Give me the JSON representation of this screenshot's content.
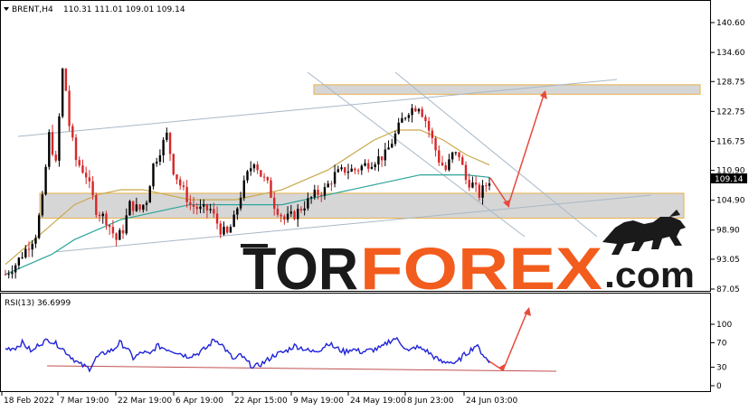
{
  "header": {
    "symbol": "BRENT,H4",
    "ohlc": "110.31 111.01 109.01 109.14"
  },
  "price_badge": "109.14",
  "rsi_header": "RSI(13) 36.6999",
  "watermark": {
    "tor": "TOR",
    "forex": "FOREX",
    "dotcom": ".com",
    "dark_color": "#1a1a1a",
    "orange_color": "#f25c1c"
  },
  "colors": {
    "bull": "#000000",
    "bear": "#d62728",
    "ma_slow": "#2ca49a",
    "ma_fast": "#c9a84a",
    "rsi": "#1f23d6",
    "trend": "#a8b8c8",
    "arrow": "#e84a3c",
    "zone_fill": "#d6d6d6",
    "zone_border": "#e8b04a"
  },
  "chart_data": [
    {
      "type": "candlestick",
      "series_name": "BRENT,H4",
      "x_ticks": [
        "18 Feb 2022",
        "7 Mar 19:00",
        "22 Mar 19:00",
        "6 Apr 19:00",
        "22 Apr 15:00",
        "9 May 19:00",
        "24 May 19:00",
        "8 Jun 23:00",
        "24 Jun 03:00"
      ],
      "y_ticks": [
        87.05,
        93.05,
        98.9,
        104.9,
        110.9,
        116.75,
        122.75,
        128.75,
        134.6,
        140.6
      ],
      "ylim": [
        87.05,
        140.6
      ],
      "last_price": 109.14,
      "path_points": [
        [
          0,
          90
        ],
        [
          3,
          92
        ],
        [
          6,
          95
        ],
        [
          9,
          98
        ],
        [
          11,
          105
        ],
        [
          13,
          118
        ],
        [
          15,
          112
        ],
        [
          17,
          131
        ],
        [
          18,
          127
        ],
        [
          19,
          120
        ],
        [
          21,
          113
        ],
        [
          24,
          110
        ],
        [
          27,
          103
        ],
        [
          30,
          101
        ],
        [
          33,
          97
        ],
        [
          35,
          99
        ],
        [
          37,
          104
        ],
        [
          40,
          103
        ],
        [
          42,
          105
        ],
        [
          44,
          112
        ],
        [
          46,
          115
        ],
        [
          48,
          118
        ],
        [
          50,
          111
        ],
        [
          52,
          108
        ],
        [
          55,
          104
        ],
        [
          58,
          103
        ],
        [
          61,
          103
        ],
        [
          64,
          99
        ],
        [
          66,
          98
        ],
        [
          68,
          101
        ],
        [
          70,
          106
        ],
        [
          72,
          110
        ],
        [
          74,
          113
        ],
        [
          76,
          110
        ],
        [
          78,
          108
        ],
        [
          80,
          104
        ],
        [
          83,
          101
        ],
        [
          86,
          102
        ],
        [
          89,
          104
        ],
        [
          92,
          106
        ],
        [
          95,
          107
        ],
        [
          98,
          110
        ],
        [
          101,
          111
        ],
        [
          104,
          111
        ],
        [
          107,
          112
        ],
        [
          110,
          113
        ],
        [
          113,
          114
        ],
        [
          116,
          118
        ],
        [
          118,
          121
        ],
        [
          120,
          123
        ],
        [
          123,
          124
        ],
        [
          125,
          121
        ],
        [
          127,
          117
        ],
        [
          129,
          113
        ],
        [
          131,
          111
        ],
        [
          133,
          114
        ],
        [
          135,
          114
        ],
        [
          137,
          109
        ],
        [
          139,
          108
        ],
        [
          141,
          106
        ],
        [
          143,
          108
        ],
        [
          144,
          109
        ]
      ],
      "zones": [
        [
          126.2,
          128.1
        ],
        [
          101.3,
          106.3
        ]
      ],
      "moving_averages": [
        {
          "name": "MA slow",
          "values": [
            90,
            92,
            94,
            97,
            99,
            101,
            102,
            103,
            104,
            104,
            104,
            104,
            104,
            105,
            106,
            107,
            108,
            109,
            110,
            110,
            110,
            109.5
          ]
        },
        {
          "name": "MA fast",
          "values": [
            92,
            96,
            100,
            104,
            106,
            107,
            107,
            106,
            105,
            105,
            105,
            106,
            107,
            109,
            111,
            114,
            117,
            119,
            119,
            117,
            114,
            112
          ]
        }
      ]
    },
    {
      "type": "line",
      "series_name": "RSI(13)",
      "y_ticks": [
        0,
        30,
        70,
        100
      ],
      "ylim": [
        0,
        100
      ],
      "last_value": 36.6999,
      "path_points": [
        [
          0,
          60
        ],
        [
          3,
          62
        ],
        [
          5,
          70
        ],
        [
          8,
          55
        ],
        [
          10,
          68
        ],
        [
          13,
          75
        ],
        [
          16,
          65
        ],
        [
          19,
          50
        ],
        [
          22,
          35
        ],
        [
          25,
          28
        ],
        [
          27,
          45
        ],
        [
          30,
          55
        ],
        [
          32,
          58
        ],
        [
          34,
          70
        ],
        [
          36,
          62
        ],
        [
          38,
          45
        ],
        [
          41,
          55
        ],
        [
          43,
          50
        ],
        [
          45,
          65
        ],
        [
          48,
          60
        ],
        [
          51,
          55
        ],
        [
          54,
          48
        ],
        [
          57,
          52
        ],
        [
          60,
          62
        ],
        [
          62,
          75
        ],
        [
          64,
          70
        ],
        [
          66,
          55
        ],
        [
          68,
          42
        ],
        [
          70,
          50
        ],
        [
          72,
          38
        ],
        [
          74,
          30
        ],
        [
          77,
          38
        ],
        [
          80,
          50
        ],
        [
          83,
          55
        ],
        [
          86,
          65
        ],
        [
          88,
          62
        ],
        [
          91,
          55
        ],
        [
          94,
          60
        ],
        [
          96,
          70
        ],
        [
          98,
          62
        ],
        [
          101,
          55
        ],
        [
          103,
          60
        ],
        [
          106,
          55
        ],
        [
          109,
          58
        ],
        [
          112,
          62
        ],
        [
          114,
          72
        ],
        [
          116,
          77
        ],
        [
          118,
          68
        ],
        [
          120,
          55
        ],
        [
          122,
          63
        ],
        [
          125,
          58
        ],
        [
          128,
          45
        ],
        [
          130,
          38
        ],
        [
          132,
          40
        ],
        [
          134,
          35
        ],
        [
          136,
          48
        ],
        [
          138,
          56
        ],
        [
          140,
          66
        ],
        [
          142,
          52
        ],
        [
          144,
          37
        ]
      ]
    }
  ]
}
